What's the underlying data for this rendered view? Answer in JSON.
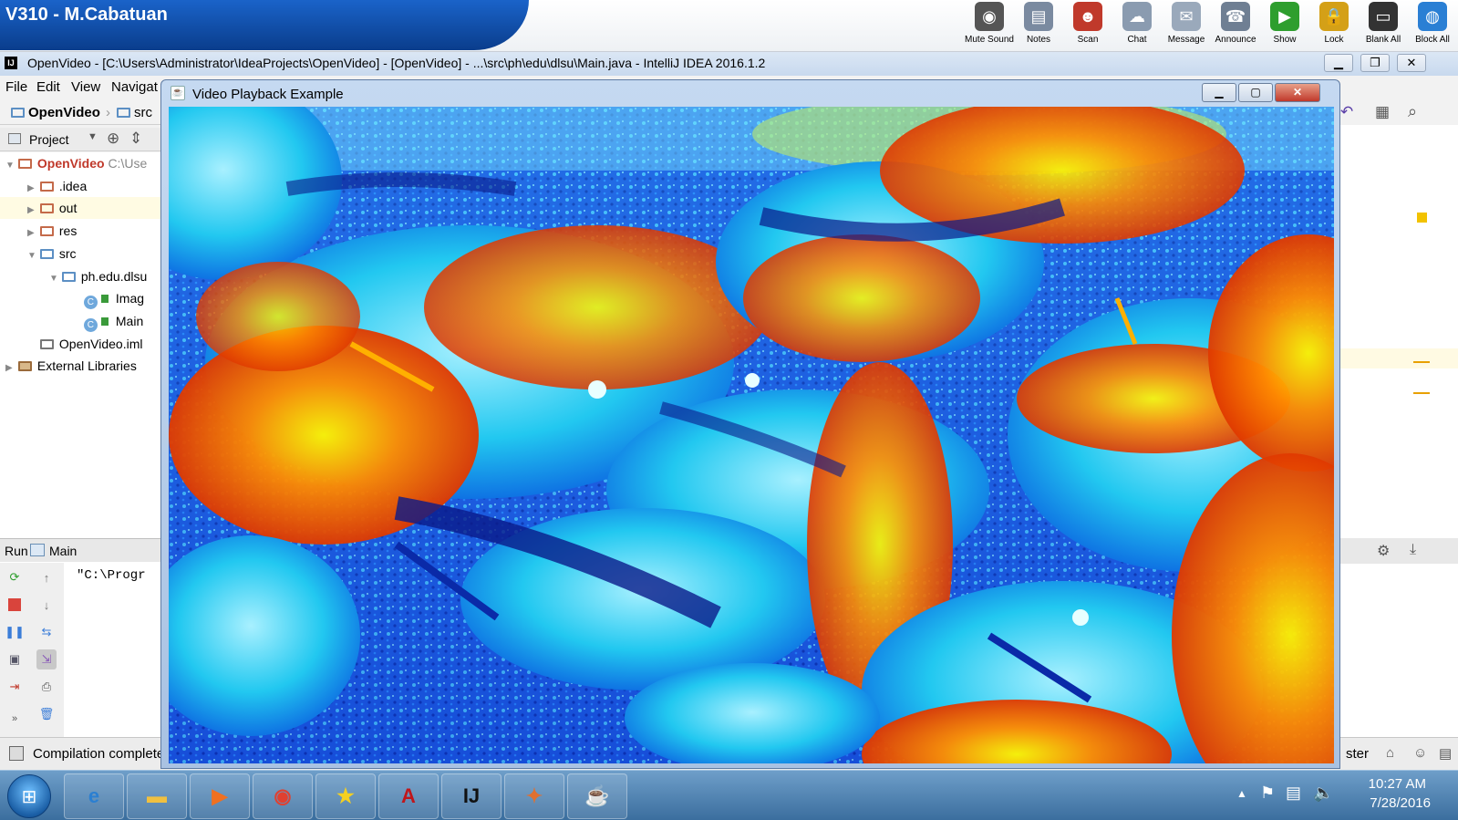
{
  "control_bar": {
    "title": "V310 - M.Cabatuan",
    "tools": [
      {
        "label": "Mute Sound",
        "icon": "speaker-icon",
        "color": "#555555",
        "glyph": "◉"
      },
      {
        "label": "Notes",
        "icon": "notes-icon",
        "color": "#7a8aa0",
        "glyph": "▤"
      },
      {
        "label": "Scan",
        "icon": "scan-icon",
        "color": "#c0392b",
        "glyph": "☻"
      },
      {
        "label": "Chat",
        "icon": "chat-icon",
        "color": "#8a9bb0",
        "glyph": "☁"
      },
      {
        "label": "Message",
        "icon": "message-icon",
        "color": "#9aa9bb",
        "glyph": "✉"
      },
      {
        "label": "Announce",
        "icon": "announce-icon",
        "color": "#6f7f93",
        "glyph": "☎"
      },
      {
        "label": "Show",
        "icon": "show-icon",
        "color": "#2e9e2e",
        "glyph": "▶"
      },
      {
        "label": "Lock",
        "icon": "lock-icon",
        "color": "#d4a017",
        "glyph": "🔒"
      },
      {
        "label": "Blank All",
        "icon": "monitor-icon",
        "color": "#333333",
        "glyph": "▭"
      },
      {
        "label": "Block All",
        "icon": "globe-icon",
        "color": "#2a7fd4",
        "glyph": "◍"
      }
    ]
  },
  "ide": {
    "title": "OpenVideo - [C:\\Users\\Administrator\\IdeaProjects\\OpenVideo] - [OpenVideo] - ...\\src\\ph\\edu\\dlsu\\Main.java - IntelliJ IDEA 2016.1.2",
    "logo": "IJ",
    "menu": [
      "File",
      "Edit",
      "View",
      "Navigat"
    ],
    "breadcrumbs": [
      "OpenVideo",
      "src"
    ],
    "project_panel_label": "Project",
    "tree": [
      {
        "label": "OpenVideo",
        "extra": "C:\\Use",
        "level": 0,
        "kind": "project",
        "open": true
      },
      {
        "label": ".idea",
        "level": 1,
        "kind": "folder",
        "open": false
      },
      {
        "label": "out",
        "level": 1,
        "kind": "folder",
        "open": false
      },
      {
        "label": "res",
        "level": 1,
        "kind": "folder",
        "open": false
      },
      {
        "label": "src",
        "level": 1,
        "kind": "src",
        "open": true
      },
      {
        "label": "ph.edu.dlsu",
        "level": 2,
        "kind": "package",
        "open": true
      },
      {
        "label": "Imag",
        "level": 3,
        "kind": "class"
      },
      {
        "label": "Main",
        "level": 3,
        "kind": "class"
      },
      {
        "label": "OpenVideo.iml",
        "level": 1,
        "kind": "file"
      },
      {
        "label": "External Libraries",
        "level": 0,
        "kind": "lib",
        "open": false
      }
    ],
    "run_label": "Run",
    "run_config": "Main",
    "console_text": "\"C:\\Progr",
    "status": "Compilation complete",
    "status_right": "ster"
  },
  "video_window": {
    "title": "Video Playback Example",
    "minimize": "▁",
    "maximize": "▢",
    "close": "✕"
  },
  "taskbar": {
    "apps": [
      {
        "name": "internet-explorer-icon",
        "glyph": "e",
        "color": "#2b7fd1"
      },
      {
        "name": "file-explorer-icon",
        "glyph": "▬",
        "color": "#f0c040"
      },
      {
        "name": "media-player-icon",
        "glyph": "▶",
        "color": "#f07020"
      },
      {
        "name": "chrome-icon",
        "glyph": "◉",
        "color": "#e04030"
      },
      {
        "name": "star-app-icon",
        "glyph": "★",
        "color": "#f5d020"
      },
      {
        "name": "acrobat-icon",
        "glyph": "A",
        "color": "#c0161b"
      },
      {
        "name": "intellij-icon",
        "glyph": "IJ",
        "color": "#111111"
      },
      {
        "name": "colorful-app-icon",
        "glyph": "✦",
        "color": "#e07030"
      },
      {
        "name": "java-icon",
        "glyph": "☕",
        "color": "#d04020"
      }
    ],
    "time": "10:27 AM",
    "date": "7/28/2016"
  }
}
